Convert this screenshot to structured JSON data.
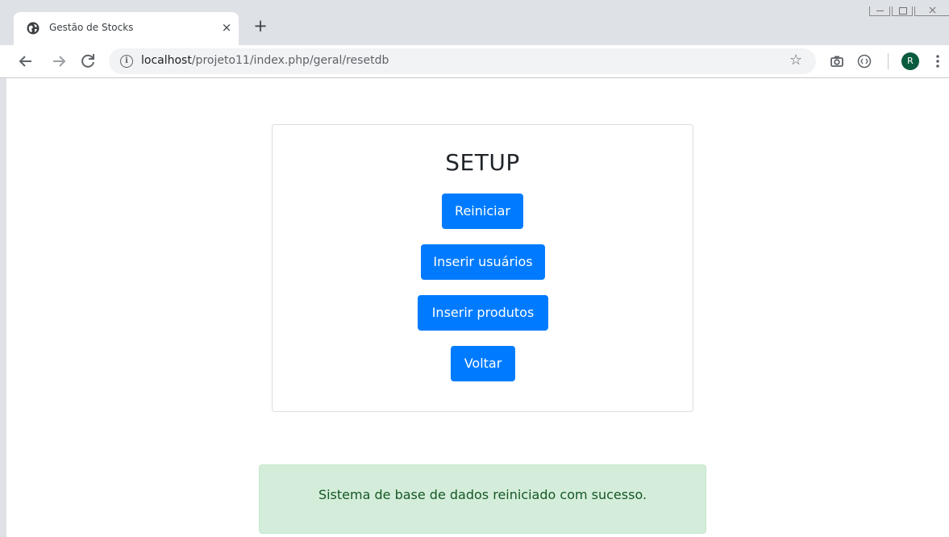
{
  "browser": {
    "tab_title": "Gestão de Stocks",
    "tab_close": "×",
    "new_tab": "+",
    "url_host": "localhost",
    "url_path": "/projeto11/index.php/geral/resetdb",
    "avatar_initial": "R"
  },
  "setup": {
    "title": "SETUP",
    "buttons": {
      "reset": "Reiniciar",
      "insert_users": "Inserir usuários",
      "insert_products": "Inserir produtos",
      "back": "Voltar"
    }
  },
  "alert": {
    "message": "Sistema de base de dados reiniciado com sucesso."
  },
  "colors": {
    "primary": "#007bff",
    "success_bg": "#d4edda",
    "success_text": "#155724"
  }
}
